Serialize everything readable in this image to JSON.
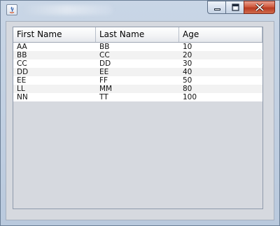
{
  "window": {
    "title": ""
  },
  "table": {
    "columns": [
      "First Name",
      "Last Name",
      "Age"
    ],
    "rows": [
      [
        "AA",
        "BB",
        "10"
      ],
      [
        "BB",
        "CC",
        "20"
      ],
      [
        "CC",
        "DD",
        "30"
      ],
      [
        "DD",
        "EE",
        "40"
      ],
      [
        "EE",
        "FF",
        "50"
      ],
      [
        "LL",
        "MM",
        "80"
      ],
      [
        "NN",
        "TT",
        "100"
      ]
    ]
  },
  "icons": {
    "app": "java-icon",
    "minimize": "minimize-icon",
    "maximize": "maximize-icon",
    "close": "close-icon"
  },
  "colors": {
    "frame": "#b9c9dd",
    "close_button": "#c8452a",
    "content_bg": "#d6d9df"
  }
}
